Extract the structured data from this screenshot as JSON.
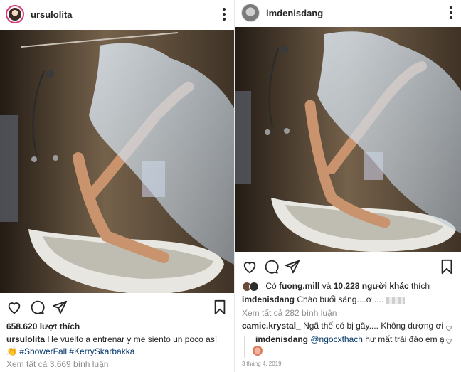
{
  "left_post": {
    "username": "ursulolita",
    "likes": "658.620 lượt thích",
    "caption_user": "ursulolita",
    "caption_text": "He vuelto a entrenar y me siento un poco así",
    "caption_emoji": "👏",
    "hashtag_1": "#ShowerFall",
    "hashtag_2": "#KerrySkarbakka",
    "view_comments": "Xem tất cả 3.669 bình luận"
  },
  "right_post": {
    "username": "imdenisdang",
    "likes_prefix": "Có",
    "likes_user": "fuong.mill",
    "likes_and": "và",
    "likes_others": "10.228 người khác",
    "likes_suffix": "thích",
    "caption_user": "imdenisdang",
    "caption_text": "Chào buổi sáng....ơ.....",
    "view_comments": "Xem tất cả 282 bình luận",
    "comment_user": "camie.krystal_",
    "comment_text": "Ngã thế có bị gãy.... Không dượng ơi?",
    "reply_user": "imdenisdang",
    "reply_mention": "@ngocxthach",
    "reply_text": "hư mất trái đào em ạ",
    "date": "3 tháng 4, 2019"
  },
  "icons": [
    "heart-icon",
    "comment-icon",
    "share-icon",
    "bookmark-icon",
    "more-options-icon"
  ]
}
